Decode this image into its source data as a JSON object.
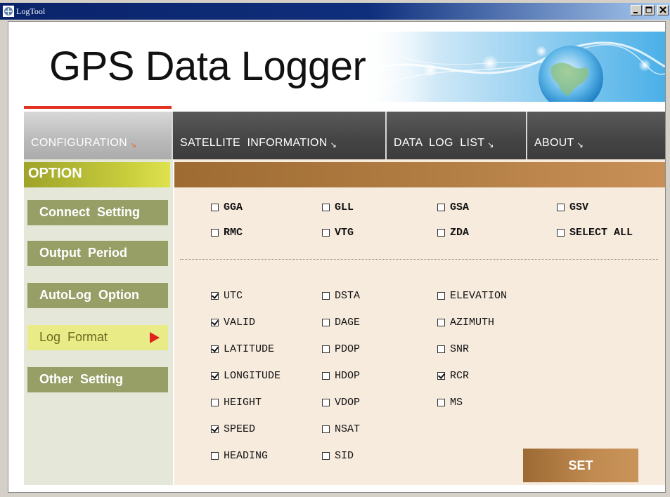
{
  "window": {
    "title": "LogTool"
  },
  "header": {
    "brand": "GPS Data Logger",
    "accent_color": "#e2321f"
  },
  "tabs": [
    {
      "label": "CONFIGURATION",
      "active": true
    },
    {
      "label": "SATELLITE  INFORMATION",
      "active": false
    },
    {
      "label": "DATA  LOG  LIST",
      "active": false
    },
    {
      "label": "ABOUT",
      "active": false
    }
  ],
  "sidebar": {
    "heading": "OPTION",
    "items": [
      {
        "label": "Connect  Setting",
        "active": false
      },
      {
        "label": "Output  Period",
        "active": false
      },
      {
        "label": "AutoLog  Option",
        "active": false
      },
      {
        "label": "Log  Format",
        "active": true
      },
      {
        "label": "Other  Setting",
        "active": false
      }
    ]
  },
  "sentences": [
    {
      "label": "GGA",
      "checked": false
    },
    {
      "label": "GLL",
      "checked": false
    },
    {
      "label": "GSA",
      "checked": false
    },
    {
      "label": "GSV",
      "checked": false
    },
    {
      "label": "RMC",
      "checked": false
    },
    {
      "label": "VTG",
      "checked": false
    },
    {
      "label": "ZDA",
      "checked": false
    },
    {
      "label": "SELECT ALL",
      "checked": false
    }
  ],
  "fields": [
    {
      "label": "UTC",
      "checked": true
    },
    {
      "label": "VALID",
      "checked": true
    },
    {
      "label": "LATITUDE",
      "checked": true
    },
    {
      "label": "LONGITUDE",
      "checked": true
    },
    {
      "label": "HEIGHT",
      "checked": false
    },
    {
      "label": "SPEED",
      "checked": true
    },
    {
      "label": "HEADING",
      "checked": false
    },
    {
      "label": "DSTA",
      "checked": false
    },
    {
      "label": "DAGE",
      "checked": false
    },
    {
      "label": "PDOP",
      "checked": false
    },
    {
      "label": "HDOP",
      "checked": false
    },
    {
      "label": "VDOP",
      "checked": false
    },
    {
      "label": "NSAT",
      "checked": false
    },
    {
      "label": "SID",
      "checked": false
    },
    {
      "label": "ELEVATION",
      "checked": false
    },
    {
      "label": "AZIMUTH",
      "checked": false
    },
    {
      "label": "SNR",
      "checked": false
    },
    {
      "label": "RCR",
      "checked": true
    },
    {
      "label": "MS",
      "checked": false
    }
  ],
  "set_button": {
    "label": "SET"
  }
}
